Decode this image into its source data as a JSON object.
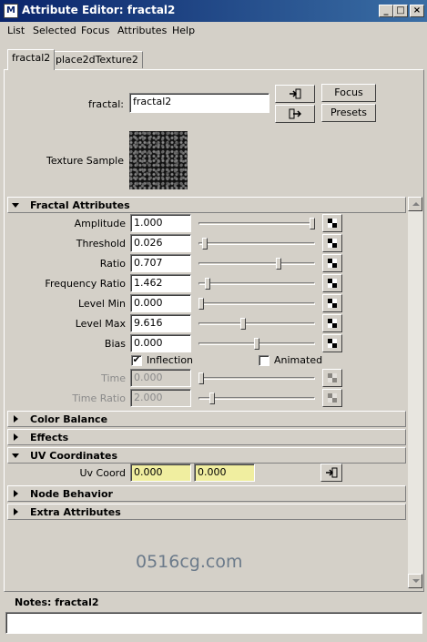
{
  "window": {
    "title": "Attribute Editor: fractal2",
    "logo": "M"
  },
  "menu": [
    "List",
    "Selected",
    "Focus",
    "Attributes",
    "Help"
  ],
  "tabs": [
    "fractal2",
    "place2dTexture2"
  ],
  "node": {
    "name_label": "fractal:",
    "name_value": "fractal2",
    "focus_label": "Focus",
    "presets_label": "Presets",
    "texture_sample_label": "Texture Sample"
  },
  "fractal_section": {
    "title": "Fractal Attributes",
    "rows": [
      {
        "label": "Amplitude",
        "value": "1.000",
        "slider_fraction": 1.0,
        "enabled": true
      },
      {
        "label": "Threshold",
        "value": "0.026",
        "slider_fraction": 0.03,
        "enabled": true
      },
      {
        "label": "Ratio",
        "value": "0.707",
        "slider_fraction": 0.7,
        "enabled": true
      },
      {
        "label": "Frequency Ratio",
        "value": "1.462",
        "slider_fraction": 0.06,
        "enabled": true
      },
      {
        "label": "Level Min",
        "value": "0.000",
        "slider_fraction": 0.0,
        "enabled": true
      },
      {
        "label": "Level Max",
        "value": "9.616",
        "slider_fraction": 0.38,
        "enabled": true
      },
      {
        "label": "Bias",
        "value": "0.000",
        "slider_fraction": 0.5,
        "enabled": true
      }
    ],
    "inflection_label": "Inflection",
    "inflection_checked": true,
    "animated_label": "Animated",
    "animated_checked": false,
    "time_row": {
      "label": "Time",
      "value": "0.000",
      "slider_fraction": 0.0,
      "enabled": false
    },
    "time_ratio_row": {
      "label": "Time Ratio",
      "value": "2.000",
      "slider_fraction": 0.1,
      "enabled": false
    }
  },
  "sections": {
    "color_balance": "Color Balance",
    "effects": "Effects",
    "uv_coordinates": "UV Coordinates",
    "node_behavior": "Node Behavior",
    "extra_attributes": "Extra Attributes"
  },
  "uv": {
    "label": "Uv Coord",
    "u": "0.000",
    "v": "0.000"
  },
  "notes": {
    "title": "Notes: fractal2",
    "value": ""
  },
  "watermark": "0516cg.com",
  "colors": {
    "titlebar": "#0a246a",
    "panel": "#d4d0c8",
    "uv_field": "#f0eea0"
  }
}
